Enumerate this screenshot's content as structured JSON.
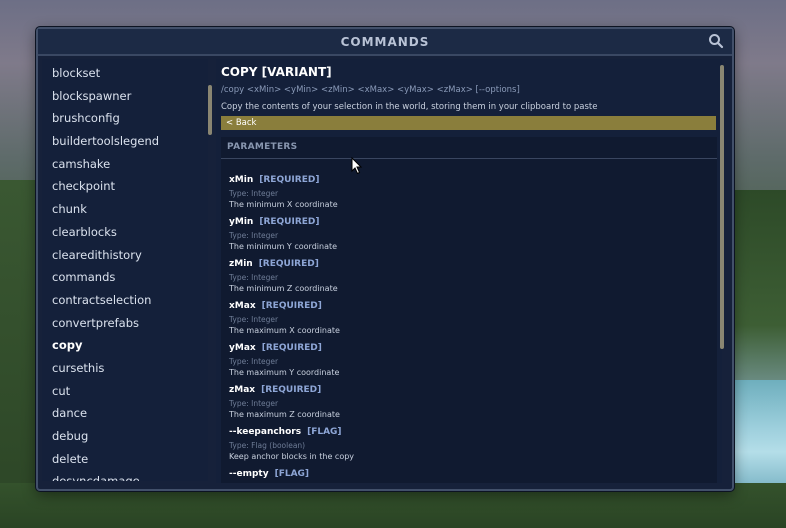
{
  "window": {
    "title": "COMMANDS"
  },
  "sidebar": {
    "items": [
      {
        "label": "blockset"
      },
      {
        "label": "blockspawner"
      },
      {
        "label": "brushconfig"
      },
      {
        "label": "buildertoolslegend"
      },
      {
        "label": "camshake"
      },
      {
        "label": "checkpoint"
      },
      {
        "label": "chunk"
      },
      {
        "label": "clearblocks"
      },
      {
        "label": "clearedithistory"
      },
      {
        "label": "commands"
      },
      {
        "label": "contractselection"
      },
      {
        "label": "convertprefabs"
      },
      {
        "label": "copy",
        "active": true
      },
      {
        "label": "cursethis"
      },
      {
        "label": "cut"
      },
      {
        "label": "dance"
      },
      {
        "label": "debug"
      },
      {
        "label": "delete"
      },
      {
        "label": "desyncdamage"
      }
    ]
  },
  "command": {
    "title": "COPY [VARIANT]",
    "usage": "/copy <xMin> <yMin> <zMin> <xMax> <yMax> <zMax> [--options]",
    "description": "Copy the contents of your selection in the world, storing them in your clipboard to paste",
    "back_label": "< Back",
    "params_header": "PARAMETERS",
    "params": [
      {
        "name": "xMin",
        "tag": "[REQUIRED]",
        "type": "Type: Integer",
        "desc": "The minimum X coordinate"
      },
      {
        "name": "yMin",
        "tag": "[REQUIRED]",
        "type": "Type: Integer",
        "desc": "The minimum Y coordinate"
      },
      {
        "name": "zMin",
        "tag": "[REQUIRED]",
        "type": "Type: Integer",
        "desc": "The minimum Z coordinate"
      },
      {
        "name": "xMax",
        "tag": "[REQUIRED]",
        "type": "Type: Integer",
        "desc": "The maximum X coordinate"
      },
      {
        "name": "yMax",
        "tag": "[REQUIRED]",
        "type": "Type: Integer",
        "desc": "The maximum Y coordinate"
      },
      {
        "name": "zMax",
        "tag": "[REQUIRED]",
        "type": "Type: Integer",
        "desc": "The maximum Z coordinate"
      },
      {
        "name": "--keepanchors",
        "tag": "[FLAG]",
        "type": "Type: Flag (boolean)",
        "desc": "Keep anchor blocks in the copy"
      },
      {
        "name": "--empty",
        "tag": "[FLAG]",
        "type": "Type: Flag (boolean)",
        "desc": ""
      }
    ]
  },
  "icons": {
    "search": "search-icon",
    "cursor": "mouse-cursor-icon"
  },
  "colors": {
    "accent": "#8a7e3c",
    "panel": "#16213a",
    "tag": "#8ea6d6"
  }
}
